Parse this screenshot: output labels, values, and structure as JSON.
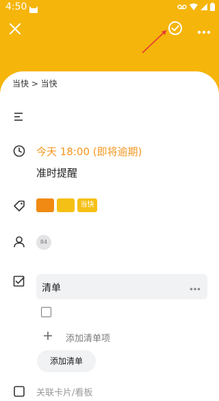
{
  "status_bar": {
    "time": "4:50"
  },
  "card": {
    "breadcrumb": "当快 > 当快",
    "due": "今天 18:00 (即将逾期)",
    "reminder": "准时提醒",
    "labels": [
      {
        "color": "#F08A12",
        "text": ""
      },
      {
        "color": "#F5C015",
        "text": ""
      },
      {
        "color": "#F5C015",
        "text": "当快"
      }
    ],
    "member": {
      "avatar_text": "84"
    },
    "checklist": {
      "title": "清单",
      "add_item_label": "添加清单项",
      "add_checklist_label": "添加清单"
    },
    "partial_row": "关联卡片/看板"
  },
  "icons": {
    "close": "close-icon",
    "confirm": "check-circle-icon",
    "more": "more-icon",
    "description": "description-icon",
    "due": "clock-icon",
    "label": "tag-icon",
    "member": "user-icon",
    "checklist": "checklist-icon"
  },
  "colors": {
    "header": "#F5B50A",
    "due_text": "#F5961E",
    "accent_annotation": "#E53935"
  }
}
